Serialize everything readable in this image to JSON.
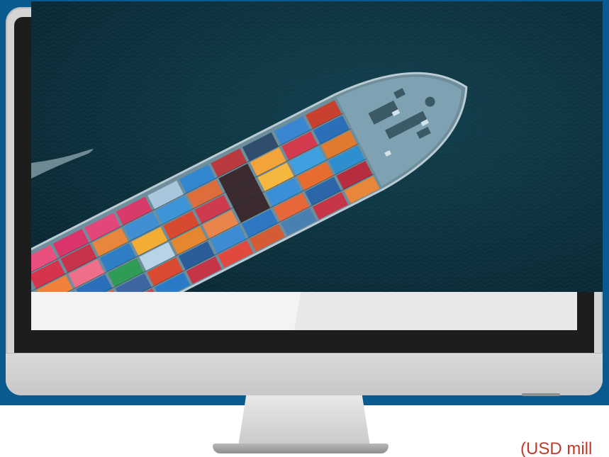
{
  "scene": {
    "photo_subject": "container-ship-aerial",
    "colors": {
      "backdrop": "#0b5a8f",
      "sea": "#10323f",
      "bezel": "#d4d4d4",
      "screen": "#1d1d1d",
      "unit_label": "#c0392b"
    }
  },
  "unit_label": "(USD mill"
}
